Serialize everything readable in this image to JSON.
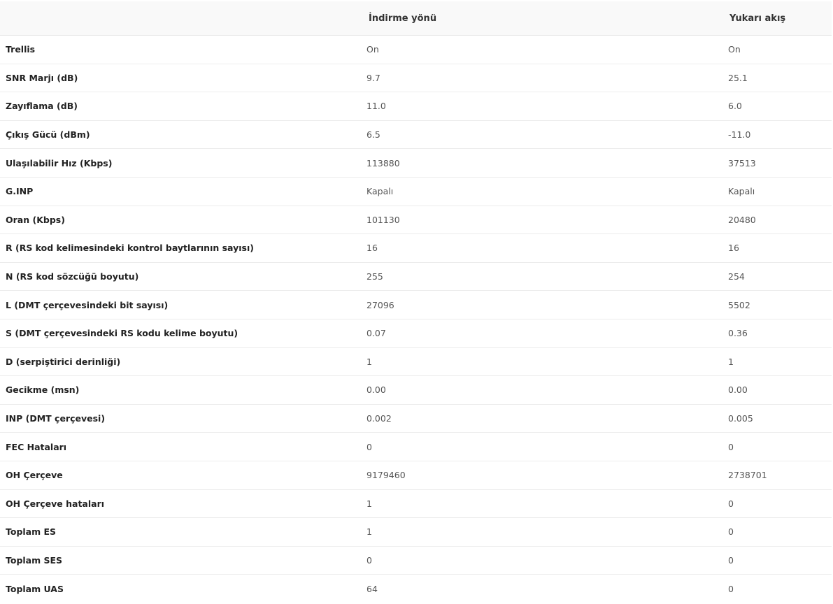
{
  "table": {
    "headers": {
      "label": "",
      "downstream": "İndirme yönü",
      "upstream": "Yukarı akış"
    },
    "rows": [
      {
        "label": "Trellis",
        "downstream": "On",
        "upstream": "On"
      },
      {
        "label": "SNR Marjı (dB)",
        "downstream": "9.7",
        "upstream": "25.1"
      },
      {
        "label": "Zayıflama (dB)",
        "downstream": "11.0",
        "upstream": "6.0"
      },
      {
        "label": "Çıkış Gücü (dBm)",
        "downstream": "6.5",
        "upstream": "-11.0"
      },
      {
        "label": "Ulaşılabilir Hız (Kbps)",
        "downstream": "113880",
        "upstream": "37513"
      },
      {
        "label": "G.INP",
        "downstream": "Kapalı",
        "upstream": "Kapalı"
      },
      {
        "label": "Oran (Kbps)",
        "downstream": "101130",
        "upstream": "20480"
      },
      {
        "label": "R (RS kod kelimesindeki kontrol baytlarının sayısı)",
        "downstream": "16",
        "upstream": "16"
      },
      {
        "label": "N (RS kod sözcüğü boyutu)",
        "downstream": "255",
        "upstream": "254"
      },
      {
        "label": "L (DMT çerçevesindeki bit sayısı)",
        "downstream": "27096",
        "upstream": "5502"
      },
      {
        "label": "S (DMT çerçevesindeki RS kodu kelime boyutu)",
        "downstream": "0.07",
        "upstream": "0.36"
      },
      {
        "label": "D (serpiştirici derinliği)",
        "downstream": "1",
        "upstream": "1"
      },
      {
        "label": "Gecikme (msn)",
        "downstream": "0.00",
        "upstream": "0.00"
      },
      {
        "label": "INP (DMT çerçevesi)",
        "downstream": "0.002",
        "upstream": "0.005"
      },
      {
        "label": "FEC Hataları",
        "downstream": "0",
        "upstream": "0"
      },
      {
        "label": "OH Çerçeve",
        "downstream": "9179460",
        "upstream": "2738701"
      },
      {
        "label": "OH Çerçeve hataları",
        "downstream": "1",
        "upstream": "0"
      },
      {
        "label": "Toplam ES",
        "downstream": "1",
        "upstream": "0"
      },
      {
        "label": "Toplam SES",
        "downstream": "0",
        "upstream": "0"
      },
      {
        "label": "Toplam UAS",
        "downstream": "64",
        "upstream": "0"
      }
    ]
  }
}
